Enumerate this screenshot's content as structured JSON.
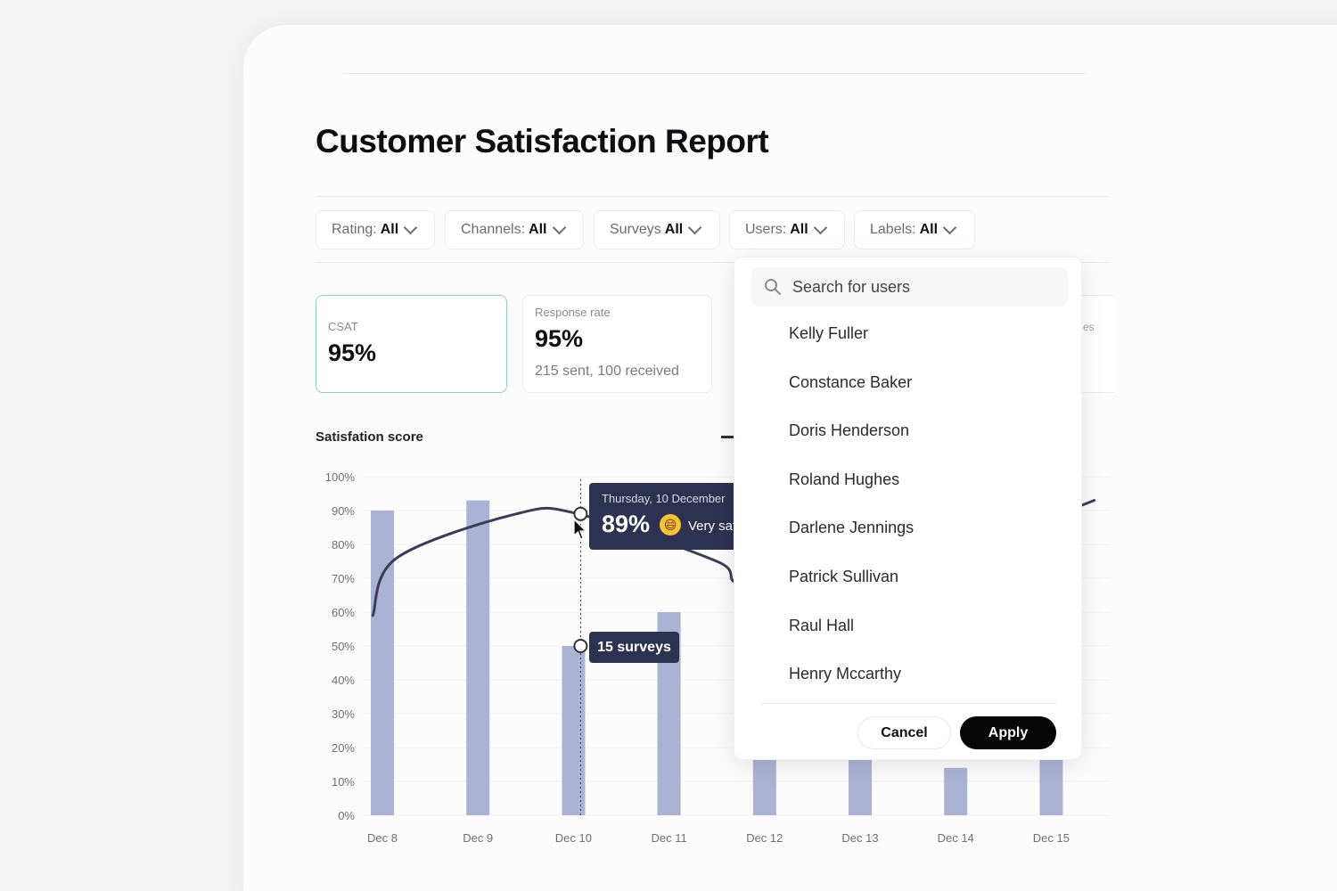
{
  "report": {
    "title": "Customer Satisfaction Report"
  },
  "filters": [
    {
      "label": "Rating:",
      "value": "All"
    },
    {
      "label": "Channels:",
      "value": "All"
    },
    {
      "label": "Surveys",
      "value": "All"
    },
    {
      "label": "Users:",
      "value": "All"
    },
    {
      "label": "Labels:",
      "value": "All"
    }
  ],
  "cards": {
    "csat": {
      "label": "CSAT",
      "value": "95%"
    },
    "response": {
      "label": "Response rate",
      "value": "95%",
      "sub": "215 sent, 100 received"
    },
    "partial_label": "es"
  },
  "chart_section": {
    "title": "Satisfation score"
  },
  "tooltip": {
    "date": "Thursday, 10 December",
    "percent": "89%",
    "emoji": "😄",
    "mood": "Very satisfied",
    "surveys": "15 surveys"
  },
  "users_dropdown": {
    "search_placeholder": "Search for users",
    "users": [
      "Kelly Fuller",
      "Constance Baker",
      "Doris Henderson",
      "Roland Hughes",
      "Darlene Jennings",
      "Patrick Sullivan",
      "Raul Hall",
      "Henry Mccarthy"
    ],
    "cancel_label": "Cancel",
    "apply_label": "Apply"
  },
  "colors": {
    "bar": "#aab3d3",
    "line": "#3a3d55",
    "tooltip_bg": "#2d3250",
    "csat_border": "#8fd0c4",
    "apply_bg": "#050505"
  },
  "chart_data": {
    "type": "bar",
    "categories": [
      "Dec 8",
      "Dec 9",
      "Dec 10",
      "Dec 11",
      "Dec 12",
      "Dec 13",
      "Dec 14",
      "Dec 15"
    ],
    "series": [
      {
        "values": [
          90,
          93,
          50,
          60,
          24,
          17,
          14,
          21
        ]
      }
    ],
    "line_series": {
      "x": [
        "Dec 8",
        "Dec 8",
        "Dec 9",
        "Dec 10",
        "Dec 11",
        "Dec 11",
        "Dec 13",
        "Dec 14",
        "Dec 15"
      ],
      "x_offsets": [
        -0.2,
        0.3,
        0.8,
        0.1,
        1.0,
        1.7,
        1.4,
        0.6,
        0.9
      ],
      "values": [
        59,
        76,
        89,
        89,
        75,
        68,
        70,
        80,
        93
      ]
    },
    "highlight_category": "Dec 10",
    "highlight_line_value": 89,
    "highlight_bar_value": 50,
    "yticks": [
      "100%",
      "90%",
      "80%",
      "70%",
      "60%",
      "50%",
      "40%",
      "30%",
      "20%",
      "10%",
      "0%"
    ],
    "ylim": [
      0,
      100
    ],
    "grid": true
  }
}
